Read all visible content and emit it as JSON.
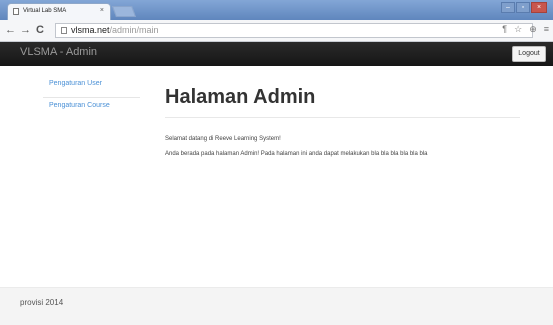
{
  "browser": {
    "tab_title": "Virtual Lab SMA",
    "tab_close": "×",
    "url_domain": "vlsma.net",
    "url_path": "/admin/main",
    "back": "←",
    "forward": "→",
    "reload": "C",
    "window_controls": {
      "minimize": "–",
      "maximize": "▫",
      "close": "×"
    },
    "toolbar_icons": {
      "extension": "¶",
      "star": "☆",
      "shield": "⊕",
      "menu": "≡"
    }
  },
  "navbar": {
    "brand": "VLSMA - Admin",
    "logout_label": "Logout"
  },
  "sidebar": {
    "items": [
      {
        "label": "Pengaturan User"
      },
      {
        "label": "Pengaturan Course"
      }
    ]
  },
  "main": {
    "title": "Halaman Admin",
    "welcome": "Selamat datang di Reeve Learning System!",
    "description": "Anda berada pada halaman Admin! Pada halaman ini anda dapat melakukan bla bla bla bla bla bla"
  },
  "footer": {
    "text": "provisi 2014"
  },
  "colors": {
    "navbar": "#1f1f1f",
    "link": "#4a90d6",
    "tabstrip": "#6e93c6"
  }
}
